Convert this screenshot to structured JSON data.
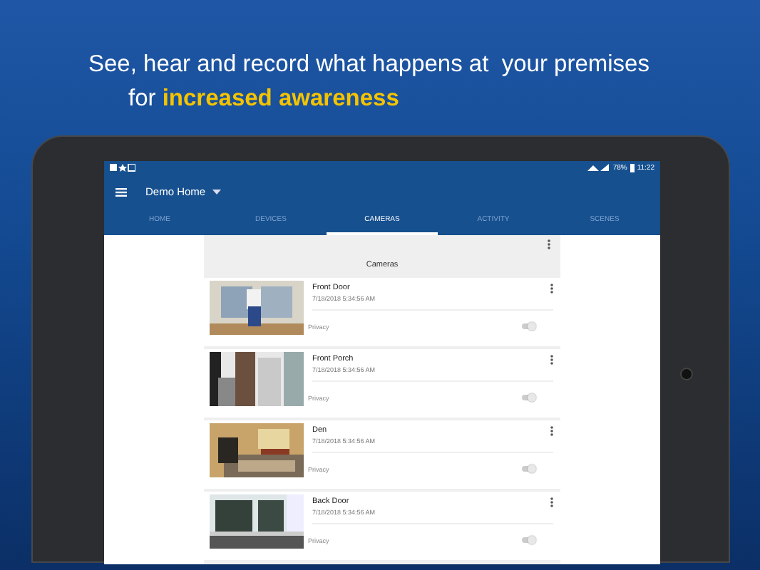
{
  "headline": {
    "line_1": "See, hear and record what happens at  your premises",
    "line_2": "for **increased awareness**"
  },
  "status_bar": {
    "battery": "78%",
    "time": "11:22"
  },
  "app_bar": {
    "title": "Demo Home"
  },
  "tabs": [
    {
      "label": "HOME",
      "selected": false
    },
    {
      "label": "DEVICES",
      "selected": false
    },
    {
      "label": "CAMERAS",
      "selected": true
    },
    {
      "label": "ACTIVITY",
      "selected": false
    },
    {
      "label": "SCENES",
      "selected": false
    }
  ],
  "cameras": {
    "title": "Cameras",
    "items": [
      {
        "name": "Front Door",
        "timestamp": "7/18/2018 5:34:56 AM",
        "privacy_label": "Privacy",
        "privacy_on": false
      },
      {
        "name": "Front Porch",
        "timestamp": "7/18/2018 5:34:56 AM",
        "privacy_label": "Privacy",
        "privacy_on": false
      },
      {
        "name": "Den",
        "timestamp": "7/18/2018 5:34:56 AM",
        "privacy_label": "Privacy",
        "privacy_on": false
      },
      {
        "name": "Back Door",
        "timestamp": "7/18/2018 5:34:56 AM",
        "privacy_label": "Privacy",
        "privacy_on": false
      }
    ]
  }
}
